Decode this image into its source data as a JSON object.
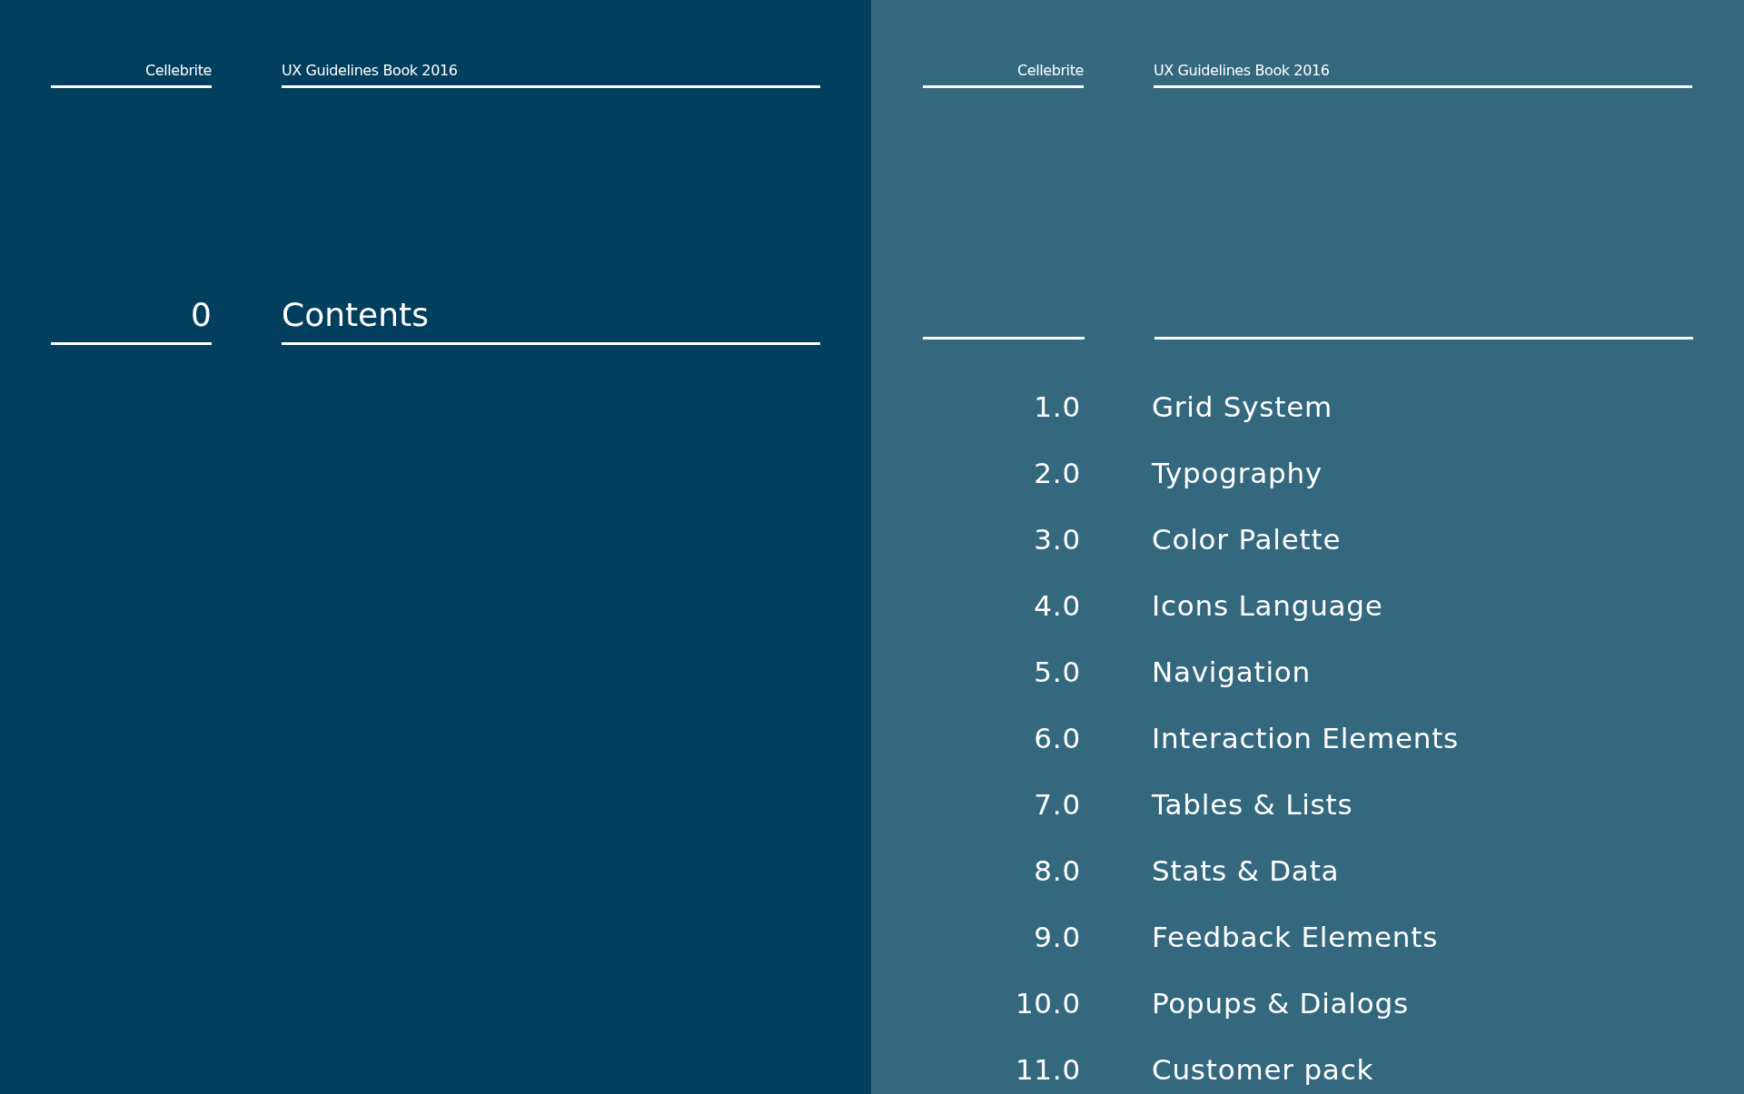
{
  "left_page": {
    "header": {
      "brand": "Cellebrite",
      "title": "UX Guidelines Book 2016"
    },
    "section": {
      "number": "0",
      "title": "Contents"
    }
  },
  "right_page": {
    "header": {
      "brand": "Cellebrite",
      "title": "UX Guidelines Book 2016"
    },
    "contents": [
      {
        "number": "1.0",
        "title": "Grid System"
      },
      {
        "number": "2.0",
        "title": "Typography"
      },
      {
        "number": "3.0",
        "title": "Color Palette"
      },
      {
        "number": "4.0",
        "title": "Icons Language"
      },
      {
        "number": "5.0",
        "title": "Navigation"
      },
      {
        "number": "6.0",
        "title": "Interaction Elements"
      },
      {
        "number": "7.0",
        "title": "Tables & Lists"
      },
      {
        "number": "8.0",
        "title": "Stats & Data"
      },
      {
        "number": "9.0",
        "title": "Feedback Elements"
      },
      {
        "number": "10.0",
        "title": "Popups & Dialogs"
      },
      {
        "number": "11.0",
        "title": "Customer pack"
      }
    ]
  }
}
